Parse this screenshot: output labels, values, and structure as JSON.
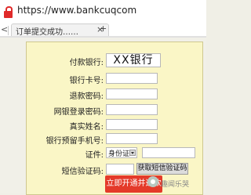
{
  "browser": {
    "url": "https://www.bankcuqcom",
    "tab_title": "订单提交成功……",
    "tab_close": "×",
    "new_tab": "+",
    "nav_arrow": "<"
  },
  "form": {
    "bank_label": "付款银行:",
    "bank_value": "XX银行",
    "card_label": "银行卡号:",
    "refund_pwd_label": "退款密码:",
    "netbank_pwd_label": "网银登录密码:",
    "name_label": "真实姓名:",
    "phone_label": "银行预留手机号:",
    "id_label": "证件:",
    "id_type": "身份证",
    "sms_label": "短信验证码:",
    "sms_button": "获取短信验证码",
    "submit_button": "立即开通并退款"
  },
  "watermark": "趣闻乐哭"
}
